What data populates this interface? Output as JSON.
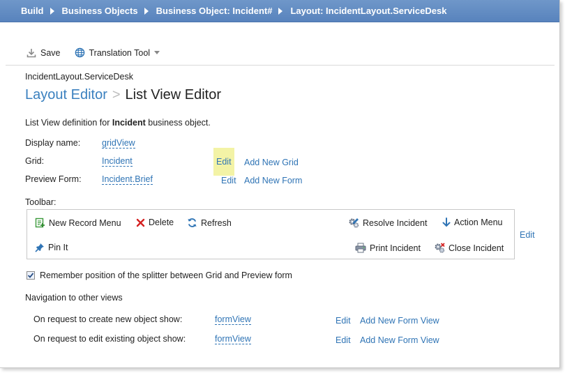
{
  "breadcrumb": {
    "items": [
      "Build",
      "Business Objects",
      "Business Object: Incident#",
      "Layout: IncidentLayout.ServiceDesk"
    ]
  },
  "toolbar": {
    "save_label": "Save",
    "translation_label": "Translation Tool"
  },
  "header": {
    "layout_name": "IncidentLayout.ServiceDesk",
    "title_part1": "Layout Editor",
    "title_separator": ">",
    "title_part2": "List View Editor"
  },
  "description": {
    "prefix": "List View definition for ",
    "object": "Incident",
    "suffix": " business object."
  },
  "fields": {
    "display_name_label": "Display name:",
    "display_name_value": "gridView",
    "grid_label": "Grid:",
    "grid_value": "Incident",
    "grid_edit": "Edit",
    "grid_add": "Add New Grid",
    "preview_label": "Preview Form:",
    "preview_value": "Incident.Brief",
    "preview_edit": "Edit",
    "preview_add": "Add New Form"
  },
  "toolbar_section": {
    "label": "Toolbar:",
    "items": {
      "new_record": "New Record Menu",
      "delete": "Delete",
      "refresh": "Refresh",
      "resolve": "Resolve Incident",
      "action_menu": "Action Menu",
      "pin": "Pin It",
      "print": "Print Incident",
      "close": "Close Incident"
    },
    "edit": "Edit"
  },
  "splitter": {
    "label": "Remember position of the splitter between Grid and Preview form",
    "checked": true
  },
  "navigation": {
    "label": "Navigation to other views",
    "create_label": "On request to create new object show:",
    "create_value": "formView",
    "create_edit": "Edit",
    "create_add": "Add New Form View",
    "edit_label": "On request to edit existing object show:",
    "edit_value": "formView",
    "edit_edit": "Edit",
    "edit_add": "Add New Form View"
  },
  "colors": {
    "breadcrumb_bg": "#5f8ac2",
    "link": "#2f74b5",
    "title_accent": "#3a80bf",
    "highlight": "#f3f3a6"
  }
}
